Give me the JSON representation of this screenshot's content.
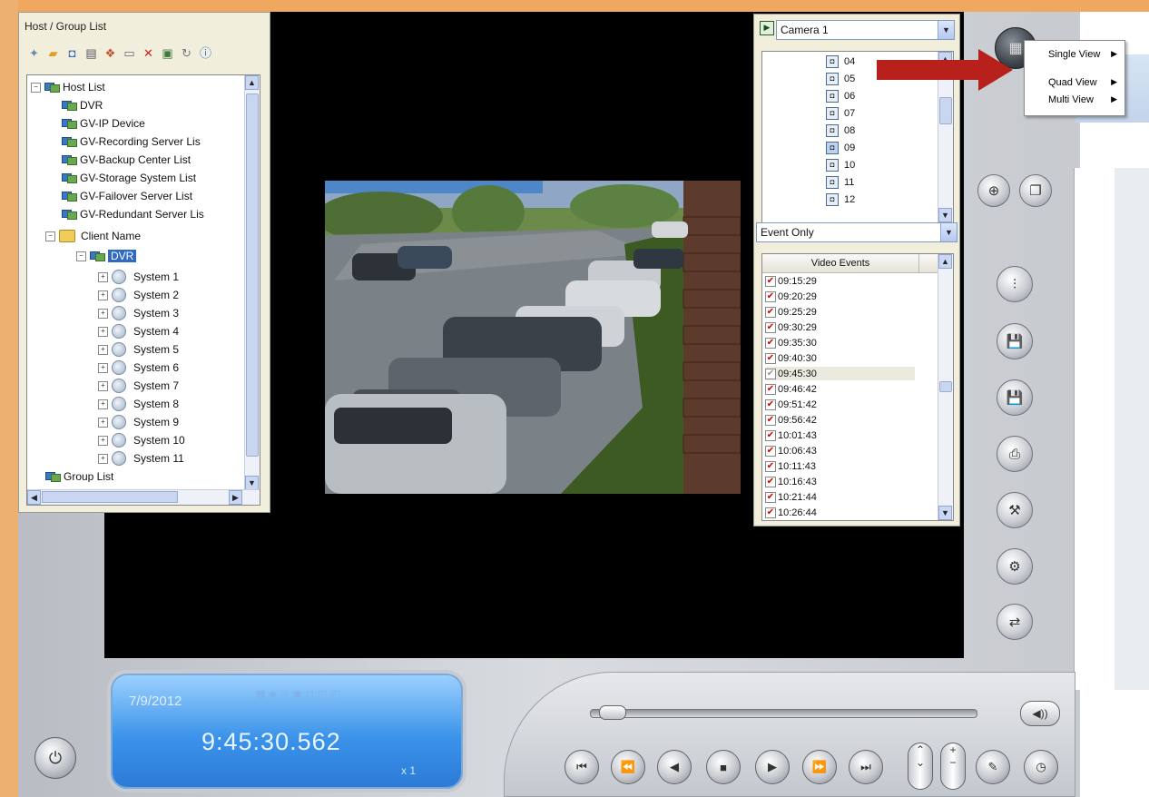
{
  "host_panel": {
    "title": "Host / Group List",
    "tree": {
      "host_list": "Host List",
      "dvr": "DVR",
      "gv_ip_device": "GV-IP Device",
      "recording_server": "GV-Recording Server Lis",
      "backup_center": "GV-Backup Center List",
      "storage_system": "GV-Storage System List",
      "failover_server": "GV-Failover Server List",
      "redundant_server": "GV-Redundant Server Lis",
      "client_name": "Client Name",
      "client_dvr": "DVR",
      "systems": [
        "System 1",
        "System 2",
        "System 3",
        "System 4",
        "System 5",
        "System 6",
        "System 7",
        "System 8",
        "System 9",
        "System 10",
        "System 11"
      ],
      "group_list": "Group List"
    }
  },
  "camera_panel": {
    "camera_select": "Camera 1",
    "cameras": [
      "04",
      "05",
      "06",
      "07",
      "08",
      "09",
      "10",
      "11",
      "12"
    ],
    "selected_camera": "09",
    "filter_select": "Event Only",
    "events_header": "Video Events",
    "events": [
      "09:15:29",
      "09:20:29",
      "09:25:29",
      "09:30:29",
      "09:35:30",
      "09:40:30",
      "09:45:30",
      "09:46:42",
      "09:51:42",
      "09:56:42",
      "10:01:43",
      "10:06:43",
      "10:11:43",
      "10:16:43",
      "10:21:44",
      "10:26:44"
    ],
    "highlighted_event": "09:45:30"
  },
  "view_menu": {
    "items": [
      "Single View",
      "Quad View",
      "Multi View"
    ]
  },
  "lcd": {
    "date": "7/9/2012",
    "time": "9:45:30.562",
    "speed": "x 1"
  },
  "colors": {
    "accent_orange": "#f0a860",
    "lcd_blue": "#3c93ea",
    "selection_blue": "#316ac5",
    "annotation_red": "#b8201c"
  }
}
